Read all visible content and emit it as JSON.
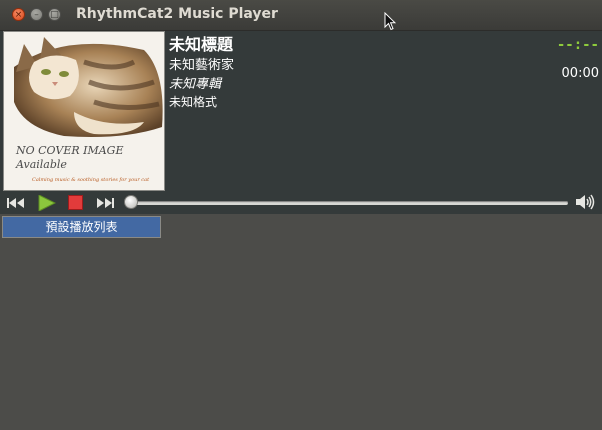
{
  "window": {
    "title": "RhythmCat2 Music Player",
    "close_symbol": "×",
    "minimize_symbol": "–",
    "maximize_symbol": "□"
  },
  "cover": {
    "line1": "NO COVER IMAGE",
    "line2": "Available",
    "tagline": "Calming music & soothing stories for your cat"
  },
  "track": {
    "title": "未知標題",
    "artist": "未知藝術家",
    "album": "未知專輯",
    "format": "未知格式"
  },
  "time": {
    "lcd": "--:--",
    "elapsed": "00:00"
  },
  "playback": {
    "seek_position": 0
  },
  "playlist": {
    "tab_label": "預設播放列表"
  },
  "colors": {
    "lcd": "#8ecb3c",
    "play": "#8bc63d",
    "stop": "#e23b3b",
    "playlist_selected": "#4369a3"
  }
}
